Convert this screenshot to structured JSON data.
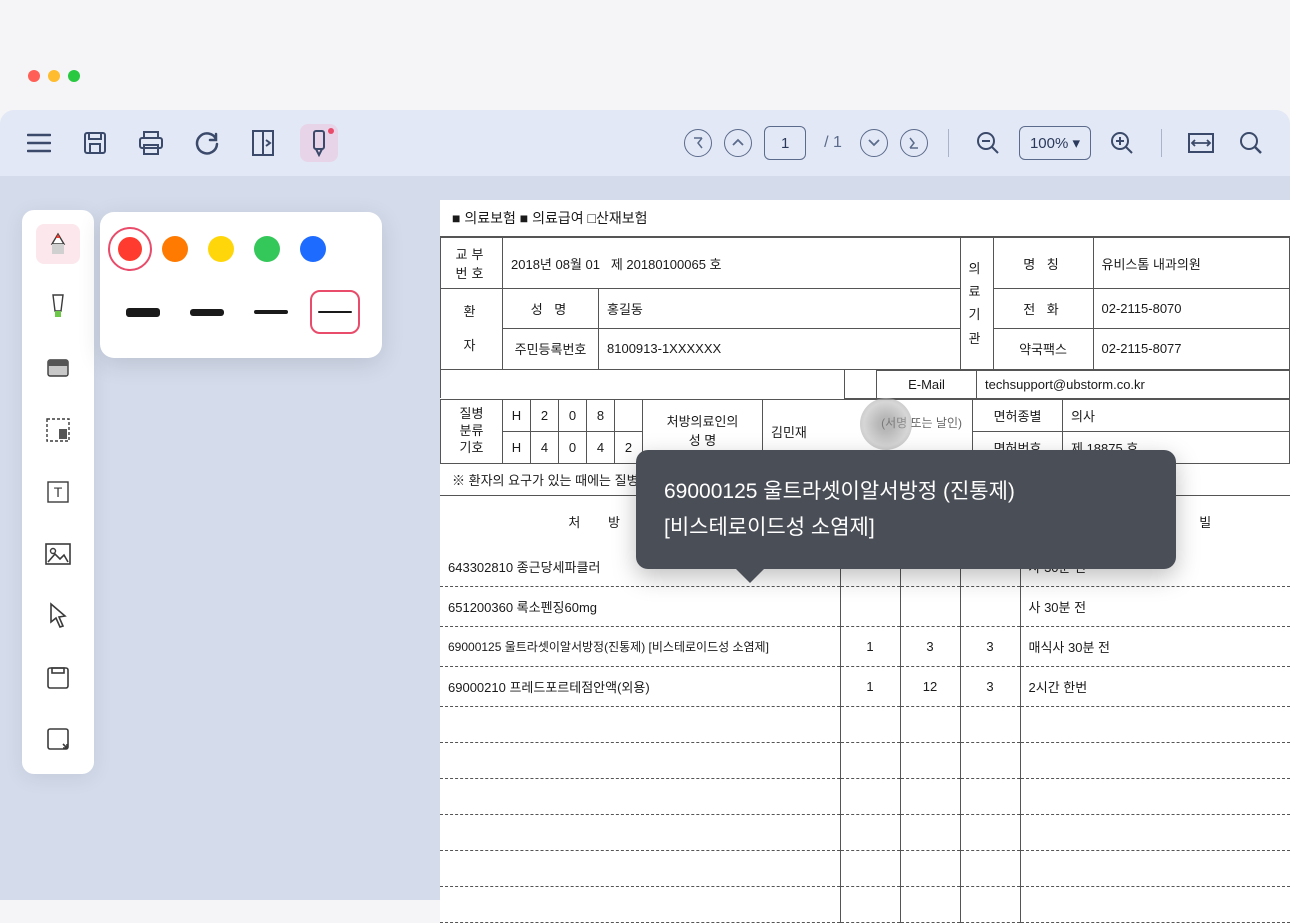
{
  "window": {
    "page_current": "1",
    "page_total": "/ 1",
    "zoom": "100% ▾"
  },
  "document": {
    "insurance_line": "■ 의료보험  ■ 의료급여  □산재보험",
    "issue_no_label": "교부\n번호",
    "issue_date": "2018년 08월 01",
    "issue_number": "제 20180100065 호",
    "patient_label": "환\n자",
    "name_label": "성       명",
    "name": "홍길동",
    "ssn_label": "주민등록번호",
    "ssn": "8100913-1XXXXXX",
    "institution_label": "의\n료\n기\n관",
    "inst_name_label": "명    칭",
    "inst_name": "유비스톰 내과의원",
    "inst_phone_label": "전    화",
    "inst_phone": "02-2115-8070",
    "inst_fax_label": "약국팩스",
    "inst_fax": "02-2115-8077",
    "inst_email_label": "E-Mail",
    "inst_email": "techsupport@ubstorm.co.kr",
    "disease_label": "질병\n분류\n기호",
    "disease_codes": [
      [
        "H",
        "2",
        "0",
        "8",
        ""
      ],
      [
        "H",
        "4",
        "0",
        "4",
        "2"
      ]
    ],
    "doctor_label": "처방의료인의\n성        명",
    "doctor_name": "김민재",
    "sign_label": "(서명 또는 날인)",
    "license_type_label": "면허종별",
    "license_type": "의사",
    "license_no_label": "면허번호",
    "license_no": "제 18875 호",
    "note_line": "※ 환자의 요구가 있는 때에는 질병분류기호를 기재하지 아니합니다",
    "rx_title": "처 방 의 약",
    "rx_col_usage": "용",
    "rx_col_when": "빌",
    "rx_rows": [
      {
        "text": "643302810 종근당세파클러",
        "a": "",
        "b": "",
        "c": "",
        "note": "사 30분 전"
      },
      {
        "text": "651200360 록소펜징60mg",
        "a": "",
        "b": "",
        "c": "",
        "note": "사 30분 전"
      },
      {
        "text": "69000125 울트라셋이알서방정(진통제) [비스테로이드성 소염제]",
        "a": "1",
        "b": "3",
        "c": "3",
        "note": "매식사 30분 전"
      },
      {
        "text": "69000210 프레드포르테점안액(외용)",
        "a": "1",
        "b": "12",
        "c": "3",
        "note": "2시간 한번"
      }
    ]
  },
  "tooltip": {
    "line1": "69000125 울트라셋이알서방정 (진통제)",
    "line2": "[비스테로이드성 소염제]"
  },
  "colors": {
    "swatches": [
      "#ff3b30",
      "#ff8a00",
      "#ffd60a",
      "#34c759",
      "#1e6bff"
    ]
  }
}
